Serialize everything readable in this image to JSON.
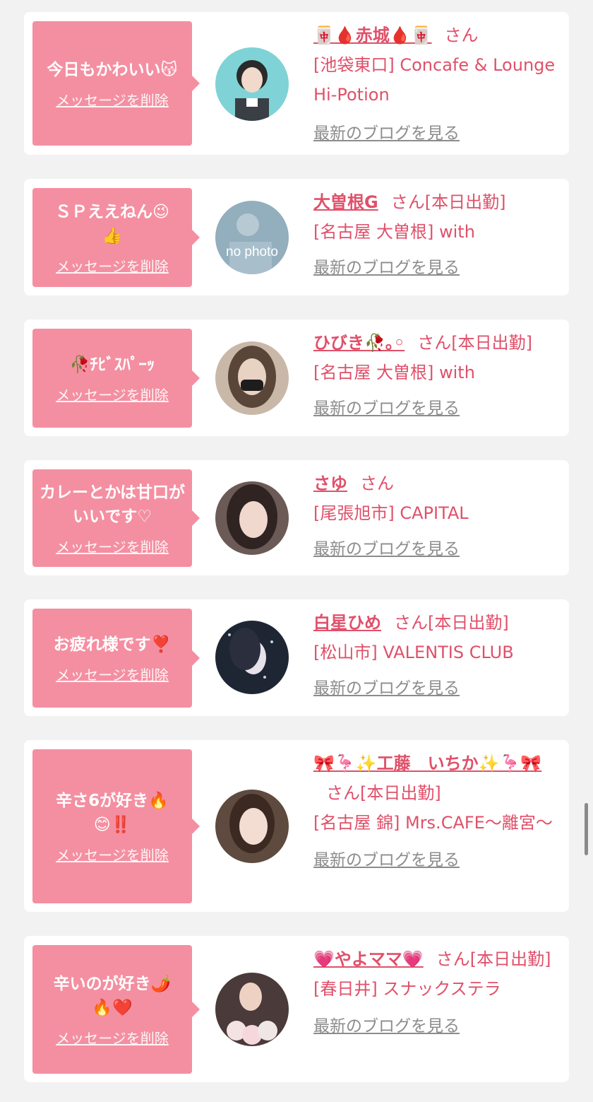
{
  "items": [
    {
      "message": "今日もかわいい😽",
      "delete_label": "メッセージを削除",
      "name": "🀄🩸赤城🩸🀄",
      "honorific": "さん",
      "status": "",
      "shop": "[池袋東口] Concafe & Lounge Hi-Potion",
      "blog_label": "最新のブログを見る",
      "avatar_icon": "avatar-photo"
    },
    {
      "message": "ＳＰええねん😉👍",
      "delete_label": "メッセージを削除",
      "name": "大曽根G",
      "honorific": "さん",
      "status": "[本日出勤]",
      "shop": "[名古屋 大曽根] with",
      "blog_label": "最新のブログを見る",
      "avatar_icon": "no-photo-placeholder",
      "avatar_text": "no photo"
    },
    {
      "message": "🥀ﾁﾋﾞｽﾊﾟｰｯ",
      "delete_label": "メッセージを削除",
      "name": "ひびき🥀｡◦",
      "honorific": "さん",
      "status": "[本日出勤]",
      "shop": "[名古屋 大曽根] with",
      "blog_label": "最新のブログを見る",
      "avatar_icon": "avatar-photo"
    },
    {
      "message": "カレーとかは甘口がいいです♡",
      "delete_label": "メッセージを削除",
      "name": "さゆ",
      "honorific": "さん",
      "status": "",
      "shop": "[尾張旭市] CAPITAL",
      "blog_label": "最新のブログを見る",
      "avatar_icon": "avatar-photo"
    },
    {
      "message": "お疲れ様です❣️",
      "delete_label": "メッセージを削除",
      "name": "白星ひめ",
      "honorific": "さん",
      "status": "[本日出勤]",
      "shop": "[松山市] VALENTIS CLUB",
      "blog_label": "最新のブログを見る",
      "avatar_icon": "avatar-photo"
    },
    {
      "message": "辛さ6が好き🔥😊‼️",
      "delete_label": "メッセージを削除",
      "name": "🎀🦩✨工藤　いちか✨🦩🎀",
      "honorific": "さん",
      "status": "[本日出勤]",
      "shop": "[名古屋 錦] Mrs.CAFE〜離宮〜",
      "blog_label": "最新のブログを見る",
      "avatar_icon": "avatar-photo"
    },
    {
      "message": "辛いのが好き🌶️🔥❤️",
      "delete_label": "メッセージを削除",
      "name": "💗やよママ💗",
      "honorific": "さん",
      "status": "[本日出勤]",
      "shop": "[春日井] スナックステラ",
      "blog_label": "最新のブログを見る",
      "avatar_icon": "avatar-photo"
    }
  ],
  "colors": {
    "bubble": "#f48fa1",
    "accent_text": "#e0506a",
    "link_gray": "#8c8c8c",
    "page_bg": "#f2f2f2"
  }
}
